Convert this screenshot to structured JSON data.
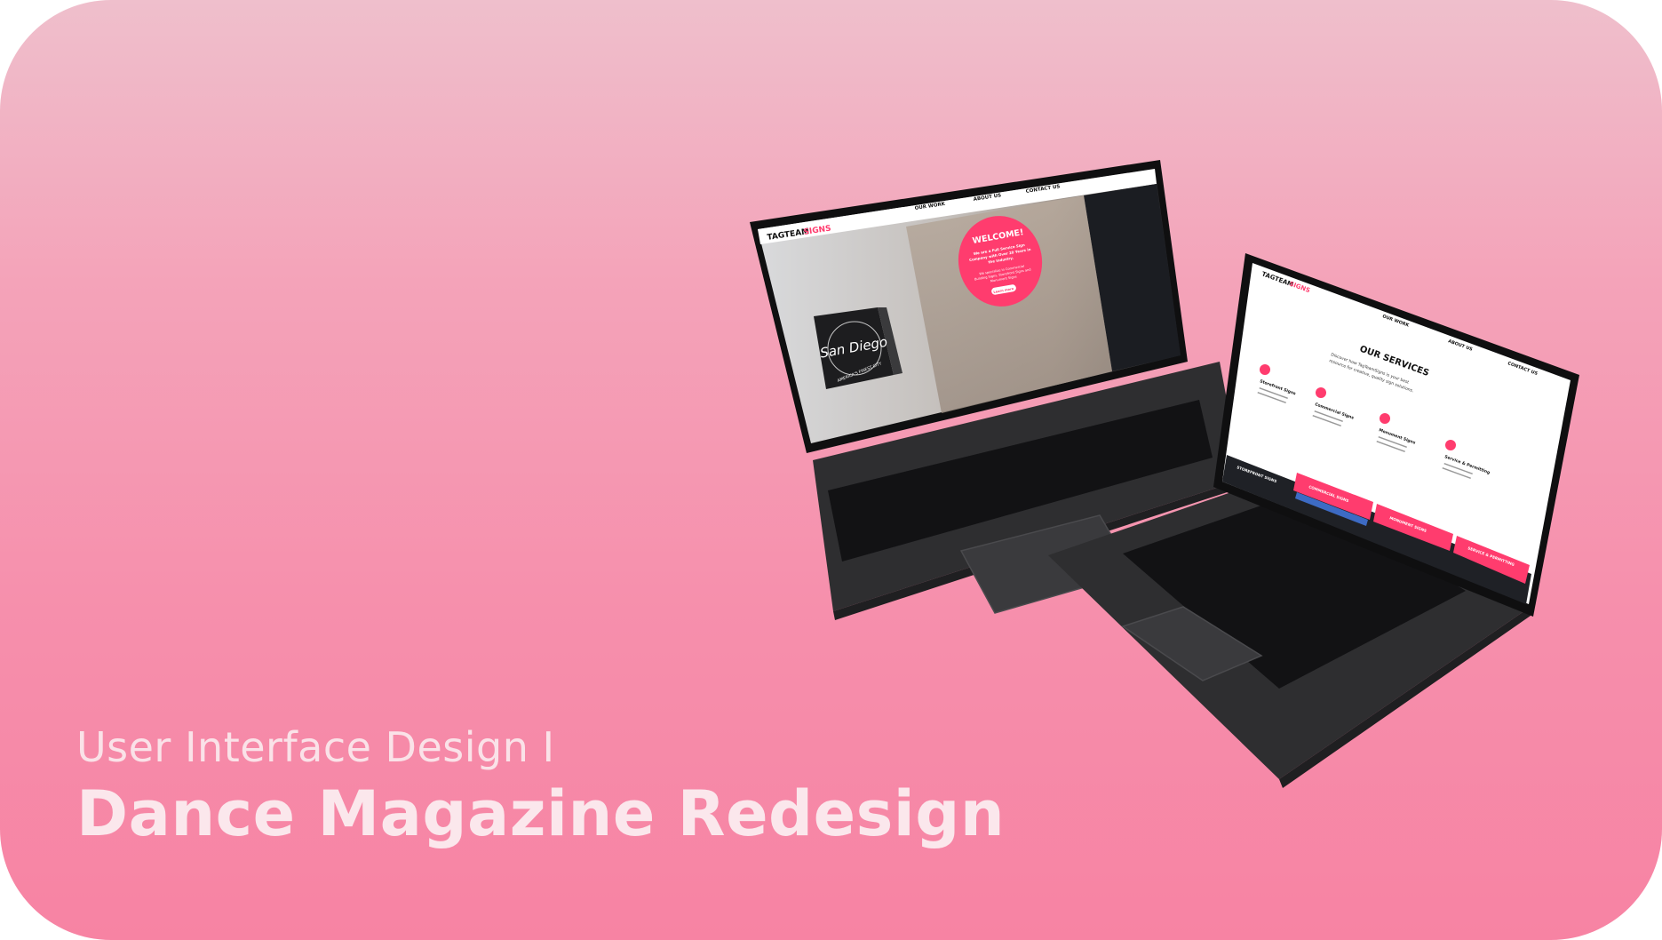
{
  "caption": {
    "subtitle": "User Interface Design I",
    "title": "Dance Magazine Redesign"
  },
  "colors": {
    "accent": "#ff3c6e",
    "laptop": "#2e2e30",
    "keys": "#121214",
    "background_top": "#efbfcc",
    "background_bottom": "#f783a3"
  },
  "left_screen": {
    "logo_a": "TAGTEAM",
    "logo_b": "SIGNS",
    "nav": [
      "OUR WORK",
      "ABOUT US",
      "CONTACT US"
    ],
    "sign_text": "San Diego",
    "sign_ring": "AMERICA'S FINEST CITY",
    "welcome_title": "WELCOME!",
    "welcome_line1": "We are a Full Service Sign",
    "welcome_line2": "Company with Over 20 Years in",
    "welcome_line3": "the Industry.",
    "welcome_body1": "We specialize in Commercial",
    "welcome_body2": "Building Signs, Storefront Signs and",
    "welcome_body3": "Monument Signs",
    "welcome_button": "Learn more"
  },
  "right_screen": {
    "logo_a": "TAGTEAM",
    "logo_b": "SIGNS",
    "nav": [
      "OUR WORK",
      "ABOUT US",
      "CONTACT US"
    ],
    "heading": "OUR SERVICES",
    "intro1": "Discover how TagTeamSigns is your best",
    "intro2": "resource for creative, quality sign solutions.",
    "services": [
      {
        "label": "Storefront Signs"
      },
      {
        "label": "Commercial Signs"
      },
      {
        "label": "Monument Signs"
      },
      {
        "label": "Service & Permitting"
      }
    ],
    "tabs": [
      "STOREFRONT SIGNS",
      "COMMERCIAL SIGNS",
      "MONUMENT SIGNS",
      "SERVICE & PERMITTING"
    ]
  }
}
